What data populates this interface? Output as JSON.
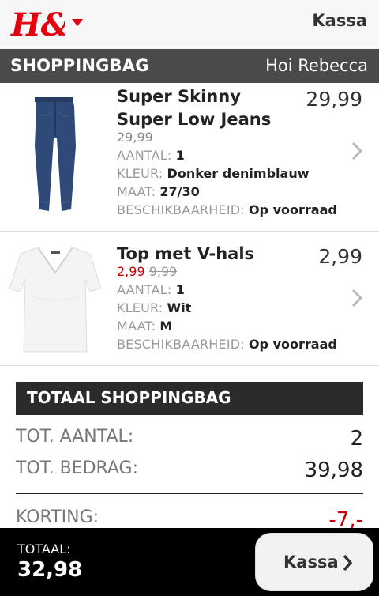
{
  "header": {
    "logo_text": "H&M",
    "checkout_label": "Kassa"
  },
  "section": {
    "title": "SHOPPINGBAG",
    "greeting": "Hoi Rebecca"
  },
  "labels": {
    "quantity": "AANTAL:",
    "color": "KLEUR:",
    "size": "MAAT:",
    "availability": "BESCHIKBAARHEID:"
  },
  "items": [
    {
      "name": "Super Skinny Super Low Jeans",
      "price": "29,99",
      "unit_price": "29,99",
      "quantity": "1",
      "color": "Donker denimblauw",
      "size": "27/30",
      "availability": "Op voorraad"
    },
    {
      "name": "Top met V-hals",
      "price": "2,99",
      "sale_price": "2,99",
      "original_price": "9,99",
      "quantity": "1",
      "color": "Wit",
      "size": "M",
      "availability": "Op voorraad"
    }
  ],
  "totals": {
    "heading": "TOTAAL SHOPPINGBAG",
    "count_label": "TOT. AANTAL:",
    "count_value": "2",
    "amount_label": "TOT. BEDRAG:",
    "amount_value": "39,98",
    "discount_label": "KORTING:",
    "discount_value": "-7,-"
  },
  "footer": {
    "total_label": "TOTAAL:",
    "total_value": "32,98",
    "button_label": "Kassa"
  },
  "colors": {
    "brand_red": "#e50010",
    "sale_red": "#cc0000"
  },
  "icons": [
    "hm-logo",
    "chevron-down-icon",
    "chevron-right-icon"
  ]
}
